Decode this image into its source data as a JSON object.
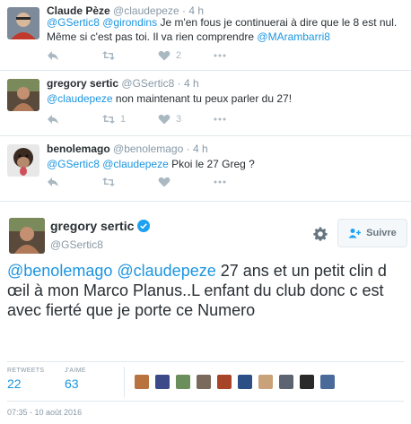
{
  "replies": [
    {
      "name": "Claude Pèze",
      "handle": "@claudepeze",
      "dot": "·",
      "time": "4 h",
      "text": [
        {
          "t": "@GSertic8",
          "mention": true
        },
        {
          "t": " ",
          "mention": false
        },
        {
          "t": "@girondins",
          "mention": true
        },
        {
          "t": " Je m'en fous je continuerai à dire que le 8 est nul. Même si c'est pas toi. Il va rien comprendre ",
          "mention": false
        },
        {
          "t": "@MArambarri8",
          "mention": true
        }
      ],
      "reply_count": "",
      "retweet_count": "",
      "like_count": "2"
    },
    {
      "name": "gregory sertic",
      "handle": "@GSertic8",
      "dot": "·",
      "time": "4 h",
      "text": [
        {
          "t": "@claudepeze",
          "mention": true
        },
        {
          "t": " non maintenant tu peux parler du 27!",
          "mention": false
        }
      ],
      "reply_count": "",
      "retweet_count": "1",
      "like_count": "3"
    },
    {
      "name": "benolemago",
      "handle": "@benolemago",
      "dot": "·",
      "time": "4 h",
      "text": [
        {
          "t": "@GSertic8",
          "mention": true
        },
        {
          "t": " ",
          "mention": false
        },
        {
          "t": "@claudepeze",
          "mention": true
        },
        {
          "t": " Pkoi le 27 Greg ?",
          "mention": false
        }
      ],
      "reply_count": "",
      "retweet_count": "",
      "like_count": ""
    }
  ],
  "main_tweet": {
    "name": "gregory sertic",
    "handle": "@GSertic8",
    "follow_label": "Suivre",
    "text": [
      {
        "t": "@benolemago",
        "mention": true
      },
      {
        "t": " ",
        "mention": false
      },
      {
        "t": "@claudepeze",
        "mention": true
      },
      {
        "t": " 27 ans et un petit clin d œil à mon Marco Planus..L enfant du club donc c est avec fierté que je porte ce Numero",
        "mention": false
      }
    ],
    "retweets_label": "RETWEETS",
    "retweets_count": "22",
    "likes_label": "J'AIME",
    "likes_count": "63",
    "date": "07:35 - 10 août 2016"
  },
  "icons": {
    "reply": "reply-icon",
    "retweet": "retweet-icon",
    "like": "heart-icon",
    "more": "more-icon",
    "gear": "gear-icon",
    "verified": "verified-badge-icon",
    "follow": "add-person-icon"
  },
  "colors": {
    "link": "#1b95e0",
    "verified": "#1da1f2",
    "muted": "#8899a6",
    "action": "#aab8c2"
  },
  "liker_colors": [
    "#b8733e",
    "#3d4a8a",
    "#6b8f5a",
    "#7a6a5c",
    "#a84428",
    "#2c4f86",
    "#c9a27a",
    "#5b6470",
    "#2a2a2a",
    "#4a6b9a"
  ]
}
